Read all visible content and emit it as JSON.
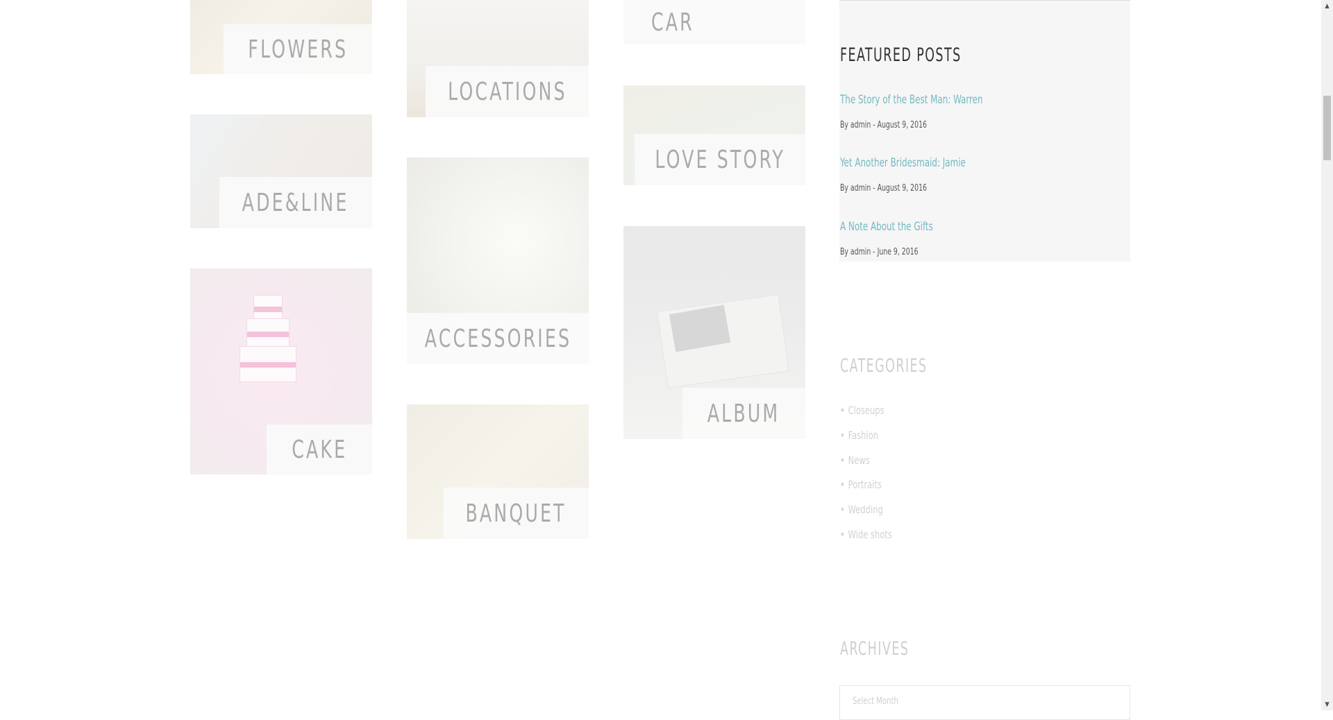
{
  "gallery": {
    "tiles": {
      "flowers": "FLOWERS",
      "locations": "LOCATIONS",
      "car": "CAR",
      "adeline": "ADE&LINE",
      "love_story": "LOVE STORY",
      "accessories": "ACCESSORIES",
      "album": "ALBUM",
      "cake": "CAKE",
      "banquet": "BANQUET"
    }
  },
  "sidebar": {
    "featured": {
      "title": "FEATURED POSTS",
      "posts": [
        {
          "title": "The Story of the Best Man: Warren",
          "meta": "By admin - August 9, 2016"
        },
        {
          "title": "Yet Another Bridesmaid: Jamie",
          "meta": "By admin - August 9, 2016"
        },
        {
          "title": "A Note About the Gifts",
          "meta": "By admin - June 9, 2016"
        }
      ]
    },
    "categories": {
      "title": "CATEGORIES",
      "items": [
        "Closeups",
        "Fashion",
        "News",
        "Portraits",
        "Wedding",
        "Wide shots"
      ]
    },
    "archives": {
      "title": "ARCHIVES",
      "select_placeholder": "Select Month"
    }
  },
  "colors": {
    "link": "#73b9c2",
    "heading_dark": "#333333",
    "faded_text": "#cfcfcf"
  }
}
